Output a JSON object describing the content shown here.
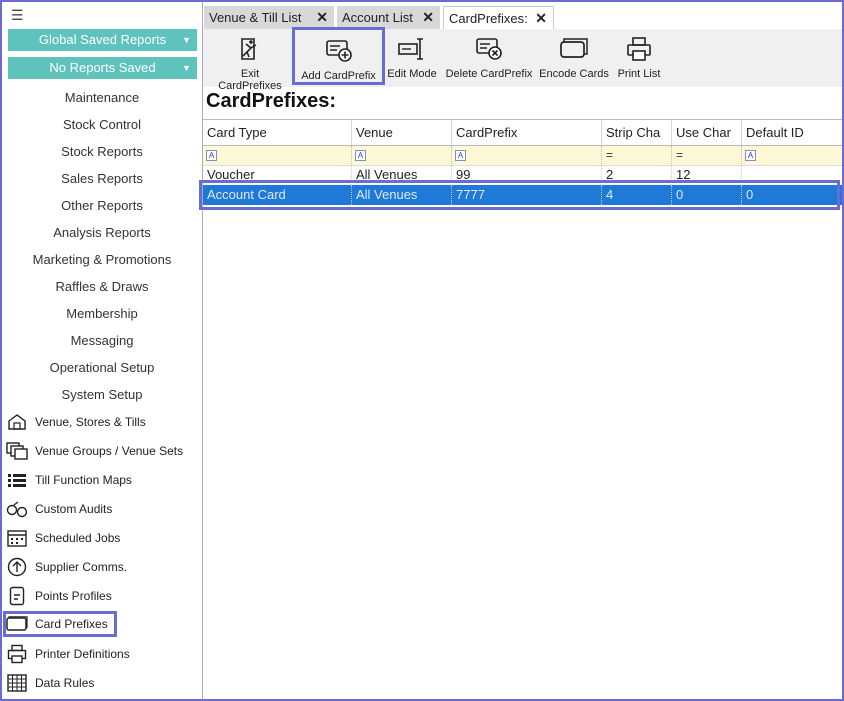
{
  "sidebar": {
    "global_saved_reports": "Global Saved Reports",
    "no_reports_saved": "No Reports Saved",
    "menu": [
      "Maintenance",
      "Stock Control",
      "Stock Reports",
      "Sales Reports",
      "Other Reports",
      "Analysis Reports",
      "Marketing & Promotions",
      "Raffles & Draws",
      "Membership",
      "Messaging",
      "Operational Setup",
      "System Setup"
    ],
    "icon_items": [
      "Venue, Stores & Tills",
      "Venue Groups / Venue Sets",
      "Till Function Maps",
      "Custom Audits",
      "Scheduled Jobs",
      "Supplier Comms.",
      "Points Profiles",
      "Card Prefixes",
      "Printer Definitions",
      "Data Rules"
    ]
  },
  "tabs": [
    "Venue & Till List",
    "Account List",
    "CardPrefixes:"
  ],
  "toolbar": {
    "exit": "Exit CardPrefixes",
    "add": "Add CardPrefix",
    "edit": "Edit Mode",
    "delete": "Delete CardPrefix",
    "encode": "Encode Cards",
    "print": "Print List"
  },
  "page_title": "CardPrefixes:",
  "grid": {
    "columns": [
      "Card Type",
      "Venue",
      "CardPrefix",
      "Strip Cha",
      "Use Char",
      "Default ID"
    ],
    "rows": [
      [
        "Voucher",
        "All Venues",
        "99",
        "2",
        "12",
        ""
      ],
      [
        "Account Card",
        "All Venues",
        "7777",
        "4",
        "0",
        "0"
      ]
    ]
  },
  "colors": {
    "accent": "#5fc3bd",
    "highlight": "#6b6bd6",
    "selection": "#1e7ad6"
  }
}
